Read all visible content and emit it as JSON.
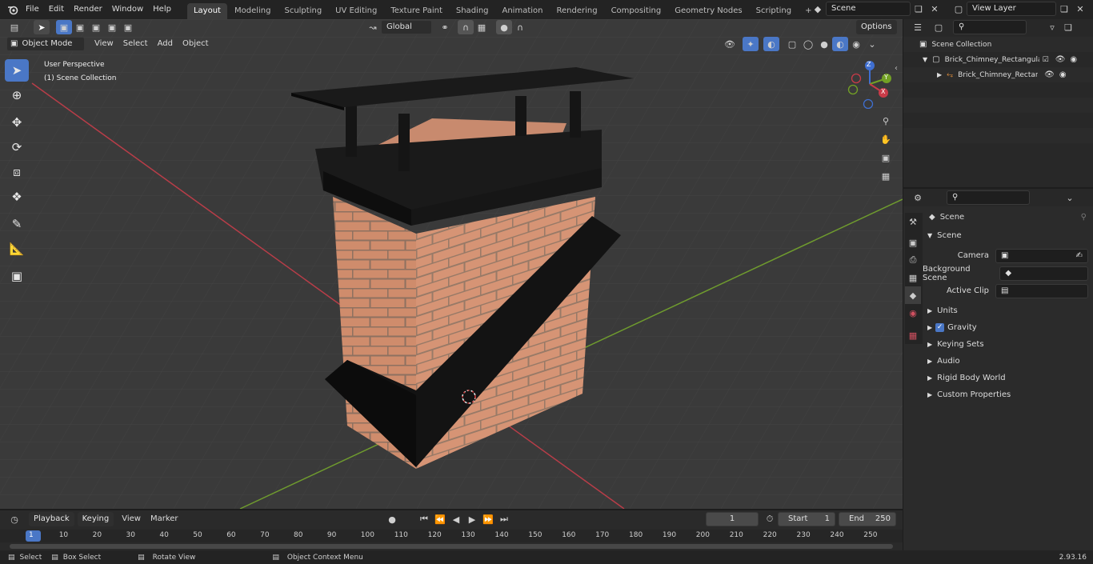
{
  "topbar": {
    "menus": [
      "File",
      "Edit",
      "Render",
      "Window",
      "Help"
    ],
    "workspaces": [
      "Layout",
      "Modeling",
      "Sculpting",
      "UV Editing",
      "Texture Paint",
      "Shading",
      "Animation",
      "Rendering",
      "Compositing",
      "Geometry Nodes",
      "Scripting"
    ],
    "active_workspace": "Layout",
    "scene_name": "Scene",
    "view_layer": "View Layer"
  },
  "viewport": {
    "mode": "Object Mode",
    "menus": [
      "View",
      "Select",
      "Add",
      "Object"
    ],
    "transform_orientation": "Global",
    "options_label": "Options",
    "overlay_line1": "User Perspective",
    "overlay_line2": "(1) Scene Collection",
    "gizmo": {
      "x": "X",
      "y": "Y",
      "z": "Z"
    }
  },
  "outliner": {
    "root": "Scene Collection",
    "collection": "Brick_Chimney_Rectangular_",
    "object": "Brick_Chimney_Rectangu"
  },
  "properties": {
    "header": "Scene",
    "panel": "Scene",
    "fields": [
      {
        "label": "Camera",
        "value": ""
      },
      {
        "label": "Background Scene",
        "value": ""
      },
      {
        "label": "Active Clip",
        "value": ""
      }
    ],
    "subpanels": [
      "Units",
      "Gravity",
      "Keying Sets",
      "Audio",
      "Rigid Body World",
      "Custom Properties"
    ],
    "gravity_checked": true
  },
  "timeline": {
    "menus": [
      "Playback",
      "Keying",
      "View",
      "Marker"
    ],
    "current_frame": "1",
    "start_label": "Start",
    "start": "1",
    "end_label": "End",
    "end": "250",
    "ruler": [
      "1",
      "10",
      "20",
      "30",
      "40",
      "50",
      "60",
      "70",
      "80",
      "90",
      "100",
      "110",
      "120",
      "130",
      "140",
      "150",
      "160",
      "170",
      "180",
      "190",
      "200",
      "210",
      "220",
      "230",
      "240",
      "250"
    ]
  },
  "status": {
    "select": "Select",
    "box_select": "Box Select",
    "rotate_view": "Rotate View",
    "context_menu": "Object Context Menu",
    "version": "2.93.16"
  },
  "colors": {
    "accent": "#4a77c6",
    "x_axis": "#b83d48",
    "y_axis": "#6f9b2e",
    "brick": "#cf8c6c",
    "metal": "#141414"
  }
}
